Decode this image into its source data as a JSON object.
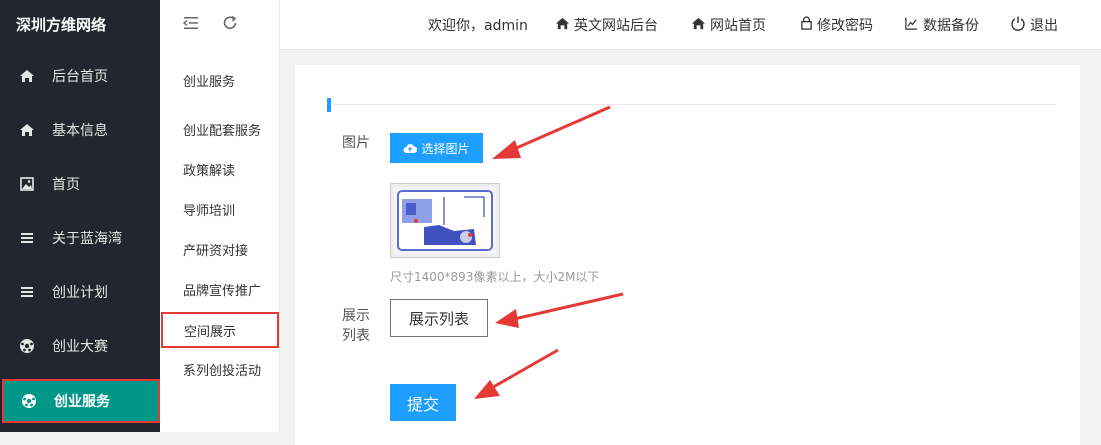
{
  "sidebar": {
    "brand": "深圳方维网络",
    "items": [
      {
        "label": "后台首页",
        "icon": "home-icon"
      },
      {
        "label": "基本信息",
        "icon": "home-icon"
      },
      {
        "label": "首页",
        "icon": "image-icon"
      },
      {
        "label": "关于蓝海湾",
        "icon": "menu-icon"
      },
      {
        "label": "创业计划",
        "icon": "menu-icon"
      },
      {
        "label": "创业大赛",
        "icon": "football-icon"
      },
      {
        "label": "创业服务",
        "icon": "football-icon",
        "active": true
      }
    ]
  },
  "subnav": {
    "header": "创业服务",
    "items": [
      "创业配套服务",
      "政策解读",
      "导师培训",
      "产研资对接",
      "品牌宣传推广",
      "空间展示",
      "系列创投活动"
    ],
    "active_index": 5
  },
  "topbar": {
    "welcome": "欢迎你，admin",
    "links": [
      {
        "label": "英文网站后台",
        "icon": "home-icon"
      },
      {
        "label": "网站首页",
        "icon": "home-icon"
      },
      {
        "label": "修改密码",
        "icon": "lock-icon"
      },
      {
        "label": "数据备份",
        "icon": "chart-icon"
      },
      {
        "label": "退出",
        "icon": "power-icon"
      }
    ]
  },
  "form": {
    "image_label": "图片",
    "choose_image": "选择图片",
    "hint": "尺寸1400*893像素以上，大小2M以下",
    "list_label_1": "展示",
    "list_label_2": "列表",
    "list_button": "展示列表",
    "submit": "提交"
  },
  "colors": {
    "sidebar_bg": "#23262e",
    "active_green": "#009688",
    "button_blue": "#1e9fff",
    "highlight_red": "#e53935"
  }
}
